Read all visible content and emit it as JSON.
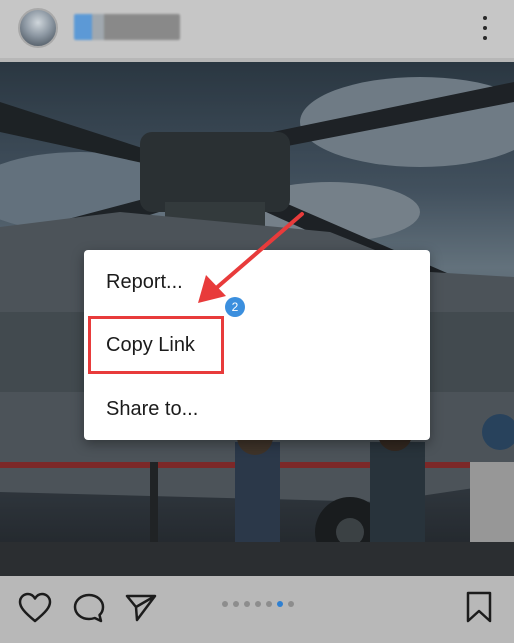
{
  "header": {
    "avatar_icon": "profile-avatar",
    "more_icon": "more-vertical-icon"
  },
  "menu": {
    "items": [
      {
        "label": "Report..."
      },
      {
        "label": "Copy Link"
      },
      {
        "label": "Share to..."
      }
    ]
  },
  "annotation": {
    "step_number": "2",
    "highlight_color": "#e83b3b",
    "badge_color": "#3b8fde"
  },
  "actions": {
    "like_icon": "heart-icon",
    "comment_icon": "comment-icon",
    "share_icon": "send-icon",
    "save_icon": "bookmark-icon"
  },
  "carousel": {
    "total": 6,
    "active_index": 5
  }
}
